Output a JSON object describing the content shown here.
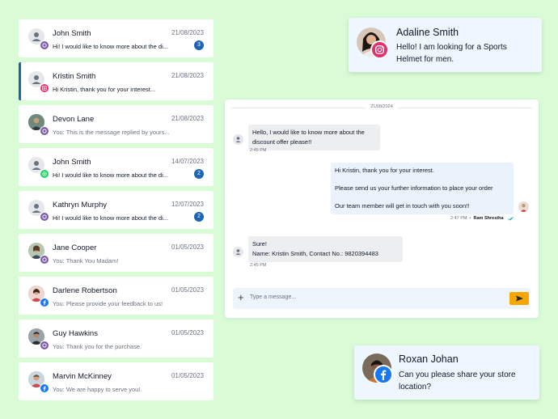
{
  "colors": {
    "background": "#d9fbd6",
    "accent": "#1c64b4",
    "send_button": "#f5a700",
    "viber": "#7b5aa6",
    "instagram": "#e1306c",
    "whatsapp": "#25d366",
    "facebook": "#1877f2"
  },
  "conversations": [
    {
      "name": "John Smith",
      "date": "21/08/2023",
      "message": "Hi! I would like to know more about the di...",
      "unread": "3",
      "channel": "viber-icon",
      "active": false
    },
    {
      "name": "Kristin Smith",
      "date": "21/08/2023",
      "message": "Hi Kristin, thank you for your interest...",
      "unread": "",
      "channel": "instagram-icon",
      "active": true
    },
    {
      "name": "Devon Lane",
      "date": "21/08/2023",
      "message": "You: This is the message replied by yours...",
      "unread": "",
      "channel": "viber-icon",
      "active": false
    },
    {
      "name": "John Smith",
      "date": "14/07/2023",
      "message": "Hi! I would like to know more about the di...",
      "unread": "2",
      "channel": "whatsapp-icon",
      "active": false
    },
    {
      "name": "Kathryn Murphy",
      "date": "12/07/2023",
      "message": "Hi! I would like to know more about the di...",
      "unread": "2",
      "channel": "viber-icon",
      "active": false
    },
    {
      "name": "Jane Cooper",
      "date": "01/05/2023",
      "message": "You: Thank You Madam!",
      "unread": "",
      "channel": "viber-icon",
      "active": false
    },
    {
      "name": "Darlene Robertson",
      "date": "01/05/2023",
      "message": "You: Please provide your feedback to us!",
      "unread": "",
      "channel": "facebook-icon",
      "active": false
    },
    {
      "name": "Guy Hawkins",
      "date": "01/05/2023",
      "message": "You: Thank you for the purchase.",
      "unread": "",
      "channel": "viber-icon",
      "active": false
    },
    {
      "name": "Marvin McKinney",
      "date": "01/05/2023",
      "message": "You: We are happy to serve you!.",
      "unread": "",
      "channel": "facebook-icon",
      "active": false
    }
  ],
  "notifications": [
    {
      "name": "Adaline Smith",
      "text": "Hello! I am looking for a Sports Helmet for men.",
      "channel": "instagram-icon"
    },
    {
      "name": "Roxan Johan",
      "text": "Can you please share your store location?",
      "channel": "facebook-icon"
    }
  ],
  "chat": {
    "date_separator": "21/08/2024",
    "messages": [
      {
        "direction": "in",
        "lines": [
          "Hello, I would like to know more about the",
          "discount offer please!!"
        ],
        "time": "2:45 PM"
      },
      {
        "direction": "out",
        "paragraphs": [
          "Hi Kristin, thank you for your interest.",
          "Please send us your further information to place your order",
          "Our team member will get in touch with you soon!!"
        ],
        "time": "2:47 PM",
        "sender": "Ram Shrestha",
        "status": "read"
      },
      {
        "direction": "in",
        "lines": [
          "Sure!",
          "Name: Kristin Smith, Contact No.: 9820394483"
        ],
        "time": "2:45 PM"
      }
    ],
    "input": {
      "placeholder": "Type a message...",
      "value": ""
    }
  }
}
